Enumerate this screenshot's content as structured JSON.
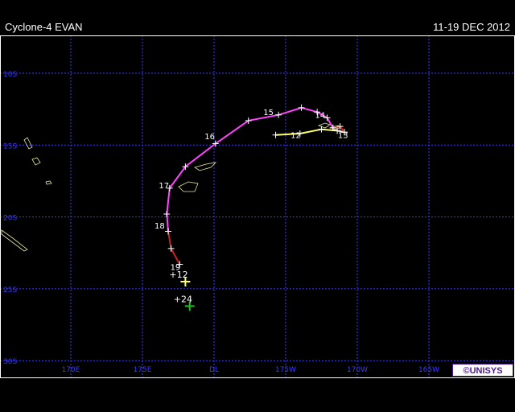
{
  "header": {
    "storm_name": "Cyclone-4  EVAN",
    "date_range": "11-19 DEC 2012"
  },
  "colors": {
    "grid": "#3a3aff",
    "land": "#e6e6a0",
    "tropical_depression": "#ffff66",
    "tropical_storm": "#ff44ff",
    "typhoon": "#aa33aa",
    "weakening": "#cc2222",
    "forecast_24": "#22bb22",
    "brand": "#4b1a8a"
  },
  "axes": {
    "lat_labels": [
      {
        "lat": -10,
        "label": "10S"
      },
      {
        "lat": -15,
        "label": "15S"
      },
      {
        "lat": -20,
        "label": "20S"
      },
      {
        "lat": -25,
        "label": "25S"
      },
      {
        "lat": -30,
        "label": "30S"
      }
    ],
    "lon_labels": [
      {
        "lon": 170,
        "label": "170E"
      },
      {
        "lon": 175,
        "label": "175E"
      },
      {
        "lon": 180,
        "label": "DL"
      },
      {
        "lon": 185,
        "label": "175W"
      },
      {
        "lon": 190,
        "label": "170W"
      },
      {
        "lon": 195,
        "label": "165W"
      }
    ]
  },
  "track": {
    "segments": [
      {
        "status": "tropical_depression",
        "points": [
          [
            184.3,
            -14.3
          ],
          [
            186.0,
            -14.2
          ],
          [
            187.5,
            -13.9
          ],
          [
            188.6,
            -14.0
          ],
          [
            189.1,
            -14.1
          ]
        ]
      },
      {
        "status": "weakening",
        "points": [
          [
            189.1,
            -14.1
          ],
          [
            188.8,
            -13.7
          ],
          [
            188.3,
            -13.8
          ]
        ]
      },
      {
        "status": "tropical_storm",
        "points": [
          [
            188.3,
            -13.8
          ],
          [
            187.9,
            -13.1
          ],
          [
            187.2,
            -12.7
          ],
          [
            186.1,
            -12.4
          ],
          [
            184.5,
            -12.9
          ],
          [
            182.4,
            -13.3
          ],
          [
            180.1,
            -14.9
          ],
          [
            178.0,
            -16.5
          ],
          [
            176.9,
            -18.0
          ],
          [
            176.7,
            -19.8
          ],
          [
            176.8,
            -21.0
          ]
        ]
      },
      {
        "status": "weakening",
        "points": [
          [
            176.8,
            -21.0
          ],
          [
            177.0,
            -22.2
          ],
          [
            177.6,
            -23.3
          ]
        ]
      }
    ],
    "day_labels": [
      {
        "lon": 185.7,
        "lat": -14.5,
        "text": "12"
      },
      {
        "lon": 189.0,
        "lat": -14.5,
        "text": "13"
      },
      {
        "lon": 187.4,
        "lat": -13.1,
        "text": "14"
      },
      {
        "lon": 183.8,
        "lat": -12.9,
        "text": "15"
      },
      {
        "lon": 179.7,
        "lat": -14.6,
        "text": "16"
      },
      {
        "lon": 176.5,
        "lat": -18.0,
        "text": "17"
      },
      {
        "lon": 176.2,
        "lat": -20.8,
        "text": "18"
      },
      {
        "lon": 177.3,
        "lat": -23.7,
        "text": "19"
      }
    ],
    "forecasts": [
      {
        "lon": 178.0,
        "lat": -24.5,
        "label": "+12",
        "status": "tropical_depression"
      },
      {
        "lon": 178.3,
        "lat": -26.2,
        "label": "+24",
        "status": "forecast_24"
      }
    ]
  }
}
